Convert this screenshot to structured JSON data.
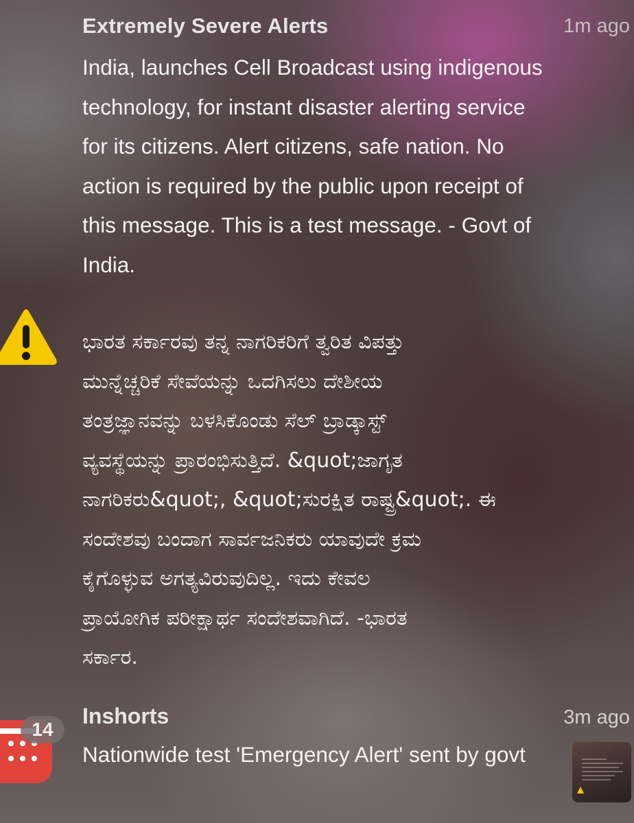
{
  "alert_notification": {
    "app_name": "Extremely Severe Alerts",
    "timestamp": "1m ago",
    "icon": "warning-triangle-icon",
    "english_text": "India, launches Cell Broadcast using indigenous\ntechnology, for instant disaster alerting service\nfor its citizens. Alert citizens, safe nation. No\naction is required by the public upon receipt of\nthis message. This is a test message. - Govt of\nIndia.",
    "kannada_text": "ಭಾರತ ಸರ್ಕಾರವು ತನ್ನ ನಾಗರಿಕರಿಗೆ ತ್ವರಿತ ವಿಪತ್ತು\nಮುನ್ನೆಚ್ಚರಿಕೆ ಸೇವೆಯನ್ನು ಒದಗಿಸಲು ದೇಶೀಯ\nತಂತ್ರಜ್ಞಾನವನ್ನು ಬಳಸಿಕೊಂಡು ಸೆಲ್ ಬ್ರಾಡ್ಕಾಸ್ಟ್\nವ್ಯವಸ್ಥೆಯನ್ನು ಪ್ರಾರಂಭಿಸುತ್ತಿದೆ. &quot;ಜಾಗೃತ\nನಾಗರಿಕರು&quot;, &quot;ಸುರಕ್ಷಿತ ರಾಷ್ಟ್ರ&quot;. ಈ\nಸಂದೇಶವು ಬಂದಾಗ ಸಾರ್ವಜನಿಕರು ಯಾವುದೇ ಕ್ರಮ\nಕೈಗೊಳ್ಳುವ ಅಗತ್ಯವಿರುವುದಿಲ್ಲ. ಇದು ಕೇವಲ\nಪ್ರಾಯೋಗಿಕ ಪರೀಕ್ಷಾರ್ಥ ಸಂದೇಶವಾಗಿದೆ. -ಭಾರತ\nಸರ್ಕಾರ.",
    "icon_color": "#f5c800"
  },
  "inshorts_notification": {
    "app_name": "Inshorts",
    "timestamp": "3m ago",
    "badge_count": "14",
    "icon": "calendar-app-icon",
    "icon_color": "#e0443b",
    "text": "Nationwide test 'Emergency Alert' sent by govt",
    "thumbnail": "screenshot-thumbnail"
  }
}
